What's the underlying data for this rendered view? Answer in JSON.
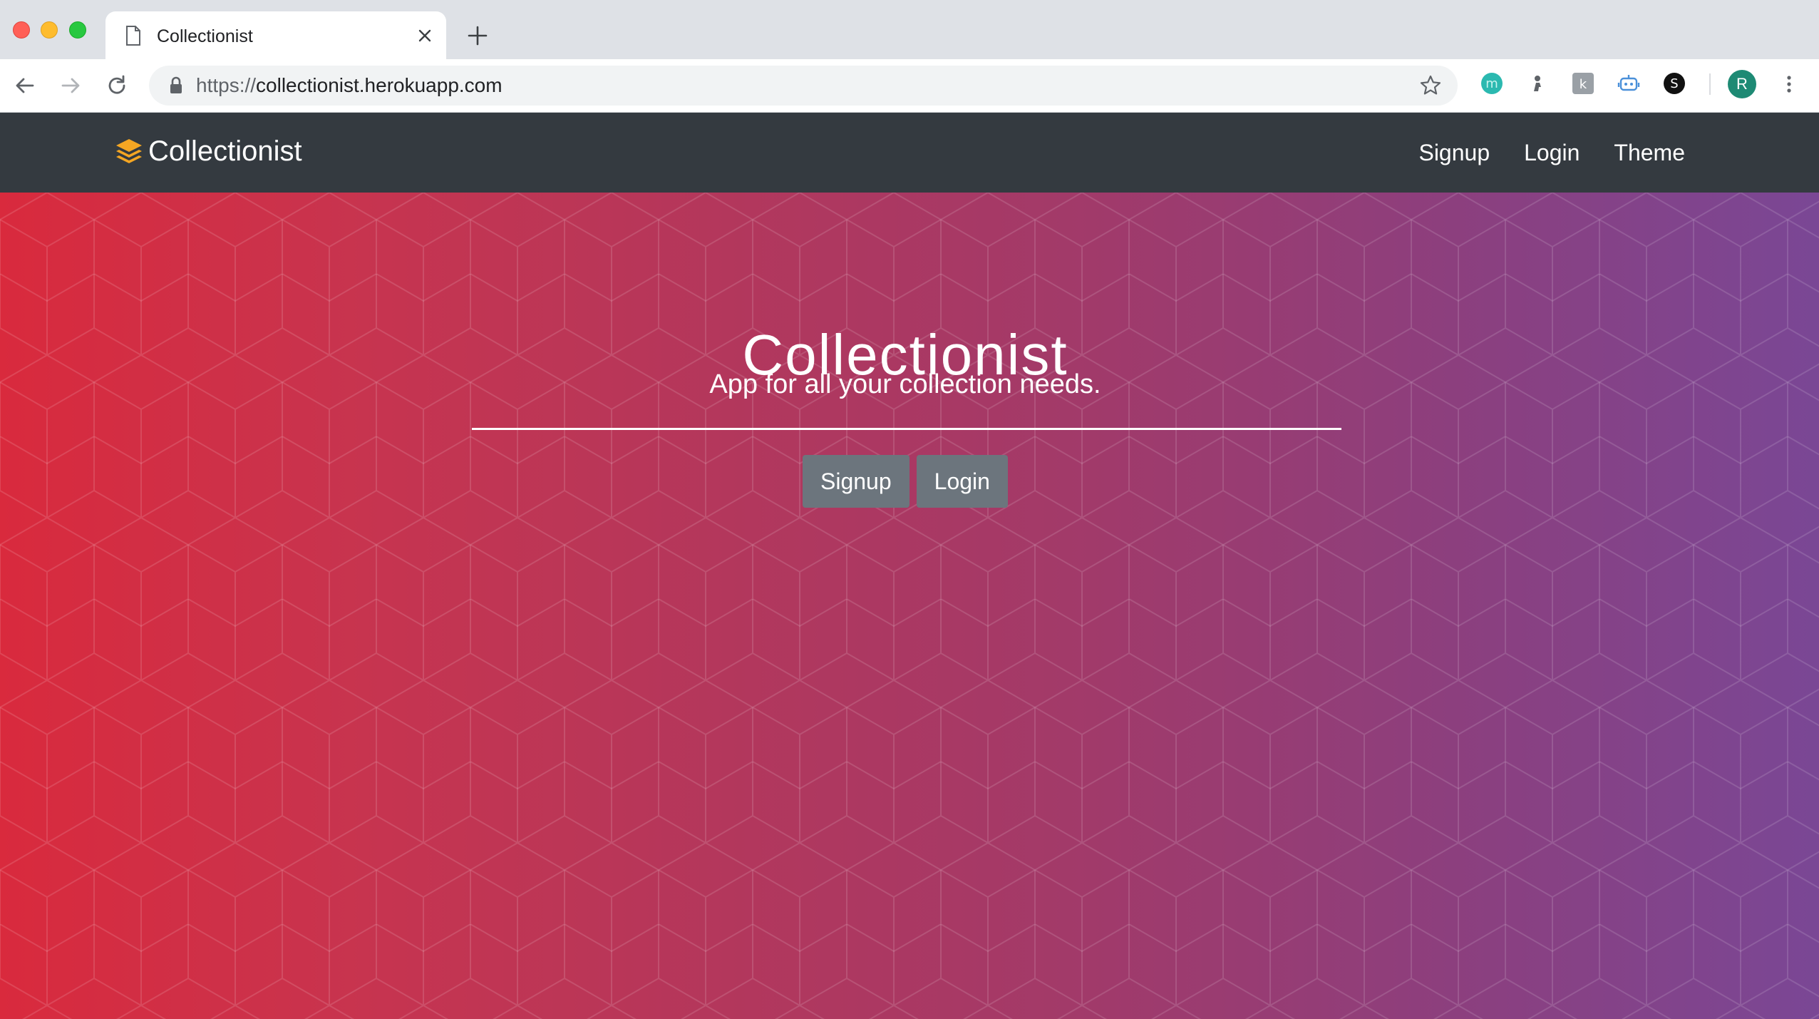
{
  "browser": {
    "tab": {
      "title": "Collectionist",
      "icon": "page-icon"
    },
    "address_bar": {
      "scheme": "https://",
      "host": "collectionist.herokuapp.com"
    },
    "extensions": [
      "m-extension-icon",
      "person-extension-icon",
      "k-extension-icon",
      "robot-extension-icon",
      "s-extension-icon"
    ],
    "profile": {
      "initial": "R",
      "color": "#1e8a74"
    }
  },
  "navbar": {
    "brand": "Collectionist",
    "brand_icon": "layers-icon",
    "links": {
      "signup": "Signup",
      "login": "Login",
      "theme": "Theme"
    }
  },
  "hero": {
    "title": "Collectionist",
    "subtitle": "App for all your collection needs.",
    "buttons": {
      "signup": "Signup",
      "login": "Login"
    }
  },
  "colors": {
    "navbar_bg": "#343a40",
    "brand_icon": "#f5a623",
    "button_bg": "#6c757d",
    "gradient_start": "#d92a3d",
    "gradient_end": "#7a4795"
  }
}
